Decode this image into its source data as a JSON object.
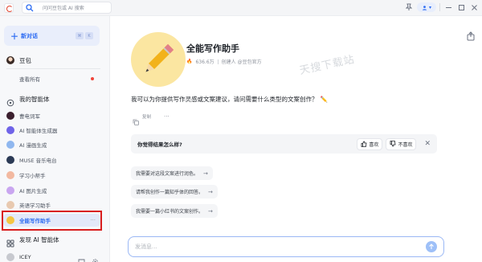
{
  "topbar": {
    "search_placeholder": "问问豆包或 AI 搜索"
  },
  "sidebar": {
    "new_chat_label": "新对话",
    "new_chat_shortcut": [
      "⌘",
      "K"
    ],
    "doubao_label": "豆包",
    "view_all_label": "查看所有",
    "my_agents_label": "我的智能体",
    "agents": [
      {
        "label": "曹电词军",
        "color": "#3b1f2e"
      },
      {
        "label": "AI 智能体生成器",
        "color": "#6f63e8"
      },
      {
        "label": "AI 漫画生成",
        "color": "#8fb7ef"
      },
      {
        "label": "MUSE 音乐电台",
        "color": "#2b3a55"
      },
      {
        "label": "学习小帮手",
        "color": "#f2b8a0"
      },
      {
        "label": "AI 图片生成",
        "color": "#c9a6f0"
      },
      {
        "label": "英语学习助手",
        "color": "#e8c9b0"
      },
      {
        "label": "全能写作助手",
        "color": "#f4c542"
      }
    ],
    "discover_label": "发现 AI 智能体",
    "user_name": "ICEY"
  },
  "bot": {
    "name": "全能写作助手",
    "fans": "636.6万",
    "creator": "创建人 @豆包官方"
  },
  "watermark": "天搜下载站",
  "chat": {
    "greeting": "我可以为你提供写作灵感或文案建议，请问需要什么类型的文案创作？",
    "copy_label": "复制",
    "feedback_question": "你觉得结果怎么样?",
    "like_label": "喜欢",
    "dislike_label": "不喜欢",
    "suggestions": [
      "我需要对这段文案进行润色。",
      "请帮我创作一篇知乎体的回答。",
      "我需要一篇小红书的文案创作。"
    ]
  },
  "input": {
    "placeholder": "发消息..."
  },
  "colors": {
    "accent": "#2c6bf2",
    "highlight_border": "#d81e1e"
  }
}
